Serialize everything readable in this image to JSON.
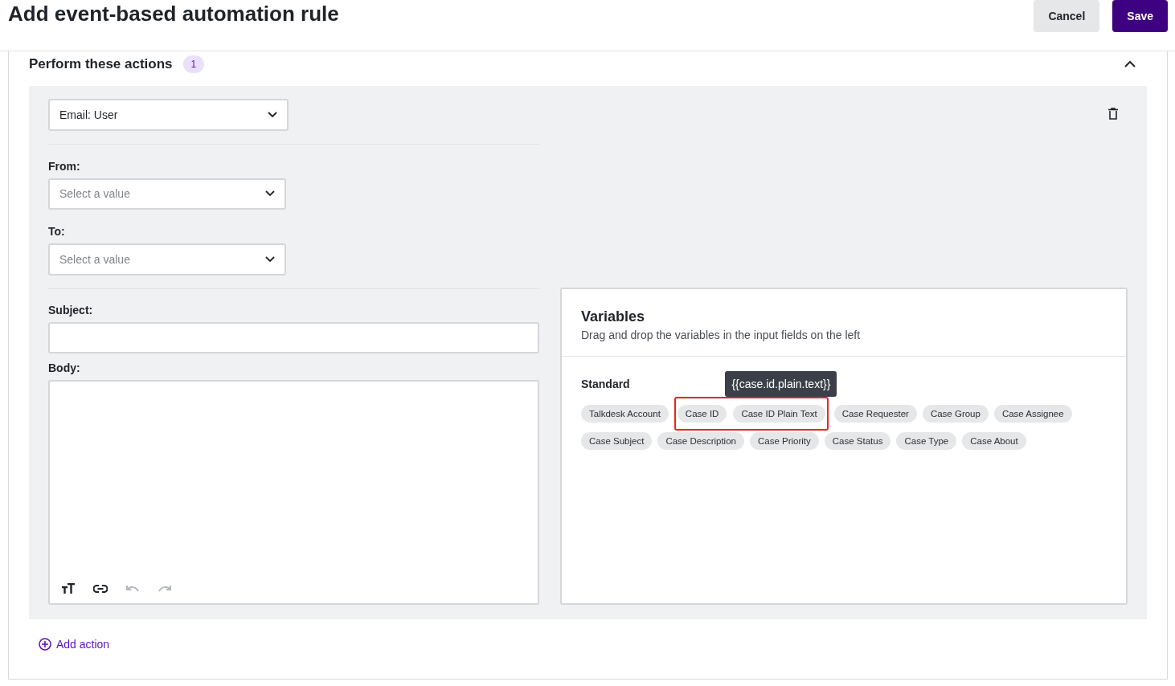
{
  "header": {
    "title": "Add event-based automation rule",
    "buttons": [
      {
        "label": "Cancel",
        "kind": "secondary"
      },
      {
        "label": "Save",
        "kind": "primary"
      }
    ]
  },
  "section": {
    "title": "Perform these actions",
    "count": "1",
    "expanded": true
  },
  "action": {
    "type_select": "Email: User",
    "fields": [
      {
        "label": "From:",
        "kind": "select",
        "placeholder": "Select a value"
      },
      {
        "label": "To:",
        "kind": "select",
        "placeholder": "Select a value"
      },
      {
        "label": "Subject:",
        "kind": "text"
      },
      {
        "label": "Body:",
        "kind": "editor"
      }
    ],
    "toolbar": [
      {
        "kind": "text-size",
        "disabled": false
      },
      {
        "kind": "link",
        "disabled": false
      },
      {
        "kind": "undo",
        "disabled": true
      },
      {
        "kind": "redo",
        "disabled": true
      }
    ]
  },
  "variables": {
    "title": "Variables",
    "subtitle": "Drag and drop the variables in the input fields on the left",
    "group": "Standard",
    "chips": [
      {
        "label": "Talkdesk Account",
        "highlighted": false
      },
      {
        "label": "Case ID",
        "highlighted": true
      },
      {
        "label": "Case ID Plain Text",
        "highlighted": true,
        "tooltip": "{{case.id.plain.text}}"
      },
      {
        "label": "Case Requester",
        "highlighted": false
      },
      {
        "label": "Case Group",
        "highlighted": false
      },
      {
        "label": "Case Assignee",
        "highlighted": false
      },
      {
        "label": "Case Subject",
        "highlighted": false
      },
      {
        "label": "Case Description",
        "highlighted": false
      },
      {
        "label": "Case Priority",
        "highlighted": false
      },
      {
        "label": "Case Status",
        "highlighted": false
      },
      {
        "label": "Case Type",
        "highlighted": false
      },
      {
        "label": "Case About",
        "highlighted": false
      }
    ]
  },
  "add_action": "Add action"
}
